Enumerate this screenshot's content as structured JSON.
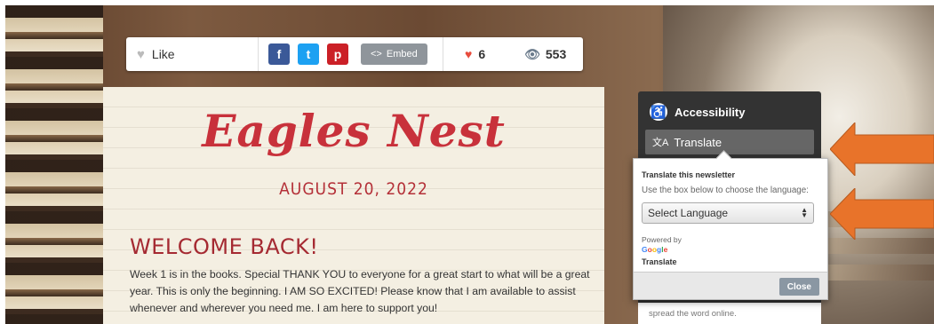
{
  "sharebar": {
    "like_label": "Like",
    "facebook_glyph": "f",
    "twitter_glyph": "t",
    "pinterest_glyph": "p",
    "embed_label": "Embed",
    "embed_icon": "<>",
    "likes_count": "6",
    "views_count": "553"
  },
  "newsletter": {
    "title": "Eagles Nest",
    "date": "AUGUST 20, 2022",
    "heading": "WELCOME BACK!",
    "body": "Week 1 is in the books. Special THANK YOU to everyone for a great start to what will be a great year. This is only the beginning. I AM SO EXCITED! Please know that I am available to assist whenever and wherever you need me. I am here to support you!"
  },
  "accessibility": {
    "title": "Accessibility",
    "translate_label": "Translate",
    "footer_text": "spread the word online."
  },
  "translate_popup": {
    "title": "Translate this newsletter",
    "description": "Use the box below to choose the language:",
    "select_value": "Select Language",
    "powered_by": "Powered by",
    "google": "Google",
    "translate": "Translate",
    "close_label": "Close"
  },
  "colors": {
    "title_red": "#c8313b",
    "arrow_orange": "#e8732a",
    "panel_dark": "#333333"
  }
}
